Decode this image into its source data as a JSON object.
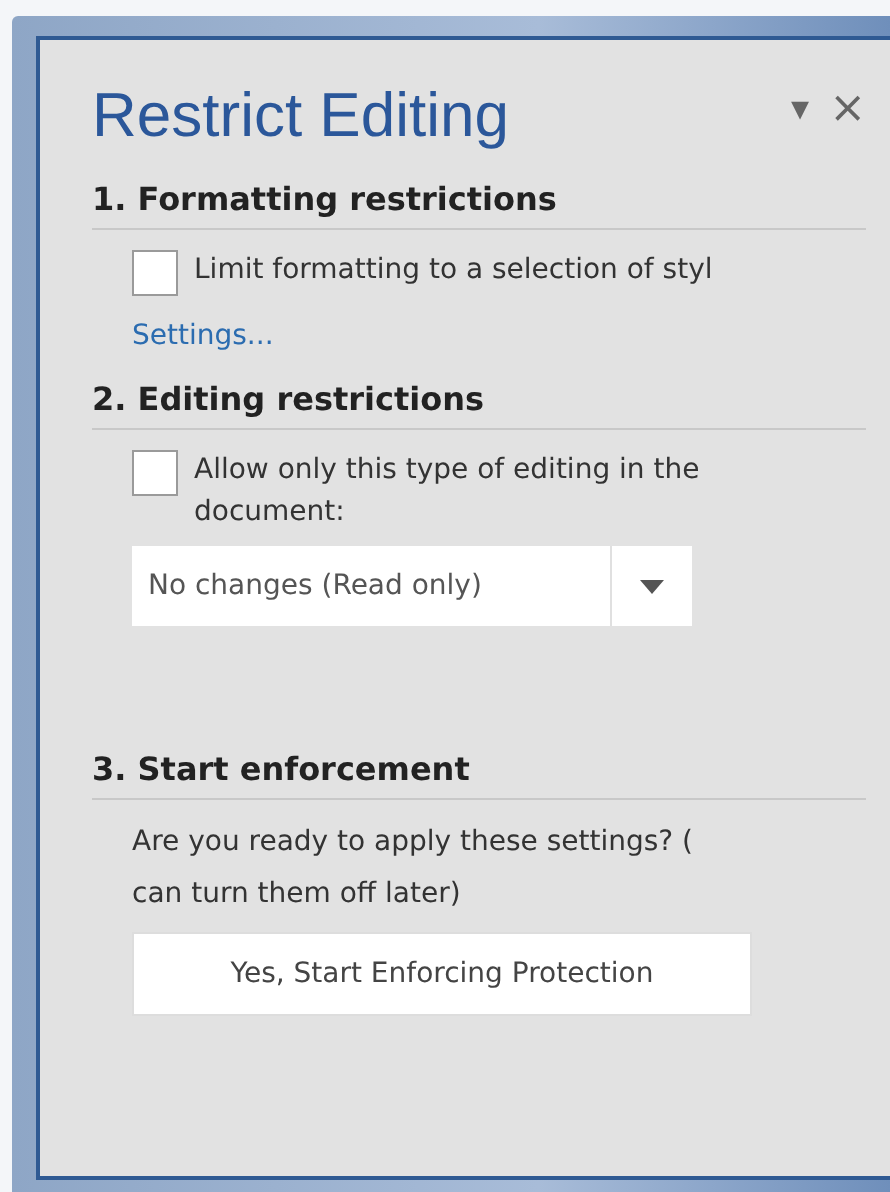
{
  "pane": {
    "title": "Restrict Editing",
    "menu_glyph": "▾",
    "close_glyph": "×"
  },
  "sections": [
    {
      "heading": "1. Formatting restrictions",
      "checkbox": {
        "label_lines": [
          "Limit formatting to a selection of styl"
        ],
        "checked": false
      },
      "link": "Settings..."
    },
    {
      "heading": "2. Editing restrictions",
      "checkbox": {
        "label_lines": [
          "Allow only this type of editing in the",
          "document:"
        ],
        "checked": false
      },
      "dropdown": {
        "value": "No changes (Read only)"
      }
    },
    {
      "heading": "3. Start enforcement",
      "text_lines": [
        "Are you ready to apply these settings? (",
        "can turn them off later)"
      ],
      "button": "Yes, Start Enforcing Protection"
    }
  ]
}
